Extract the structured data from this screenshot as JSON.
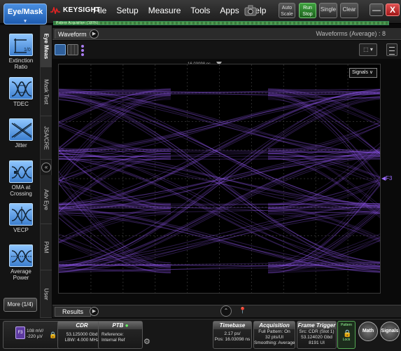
{
  "toolbar": {
    "eye_mask_label": "Eye/Mask",
    "logo_text": "KEYSIGHT",
    "menu": [
      "File",
      "Setup",
      "Measure",
      "Tools",
      "Apps",
      "Help"
    ],
    "auto_scale_l1": "Auto",
    "auto_scale_l2": "Scale",
    "run_stop_l1": "Run",
    "run_stop_l2": "Stop",
    "single_label": "Single",
    "clear_label": "Clear",
    "minimize_label": "—",
    "close_label": "X"
  },
  "acquisition_progress": {
    "label": "Pattern Acquisition: (100%)",
    "percent": 100
  },
  "sidebar": {
    "tab_label": "Eye Meas",
    "items": [
      {
        "label": "Extinction Ratio",
        "icon": "extinction-ratio-icon",
        "value_text": "1/0"
      },
      {
        "label": "TDEC",
        "icon": "tdec-icon"
      },
      {
        "label": "Jitter",
        "icon": "jitter-icon"
      },
      {
        "label": "OMA at Crossing",
        "icon": "oma-crossing-icon"
      },
      {
        "label": "VECP",
        "icon": "vecp-icon"
      },
      {
        "label": "Average Power",
        "icon": "average-power-icon"
      }
    ],
    "more_label": "More (1/4)"
  },
  "vertical_tabs": [
    "Eye Meas",
    "Mask Test",
    "JSA/CRE",
    "Adv Eye",
    "PAM",
    "User"
  ],
  "waveform": {
    "tab_label": "Waveform",
    "info": "Waveforms (Average) : 8",
    "time_marker": "16.03098 ns",
    "signals_label": "Signals",
    "marker_label": "F3",
    "trace_color": "#9b5cff"
  },
  "results": {
    "tab_label": "Results"
  },
  "status": {
    "channel_icon_text": "F3",
    "channel_scale": "108 mV/",
    "channel_offset": "-220 µV",
    "cdr": {
      "title": "CDR",
      "line1": "53.125000 Gbd",
      "line2": "LBW: 4.000 MHz"
    },
    "ptb": {
      "title": "PTB",
      "line1": "Reference:",
      "line2": "Internal Ref"
    },
    "timebase": {
      "title": "Timebase",
      "line1": "2.17 ps/",
      "line2": "Pos: 16.03098 ns"
    },
    "acquisition": {
      "title": "Acquisition",
      "line1": "Full Pattern: On",
      "line2": "32 pts/UI",
      "line3": "Smoothing: Average"
    },
    "frame_trigger": {
      "title": "Frame Trigger",
      "line1": "Src: CDR (Slot 1)",
      "line2": "53.124020 Gbd",
      "line3": "8191 UI"
    },
    "pattern_lock_top": "Pattern",
    "pattern_lock_bottom": "Lock",
    "math_label": "Math",
    "signals_label": "Signals"
  }
}
